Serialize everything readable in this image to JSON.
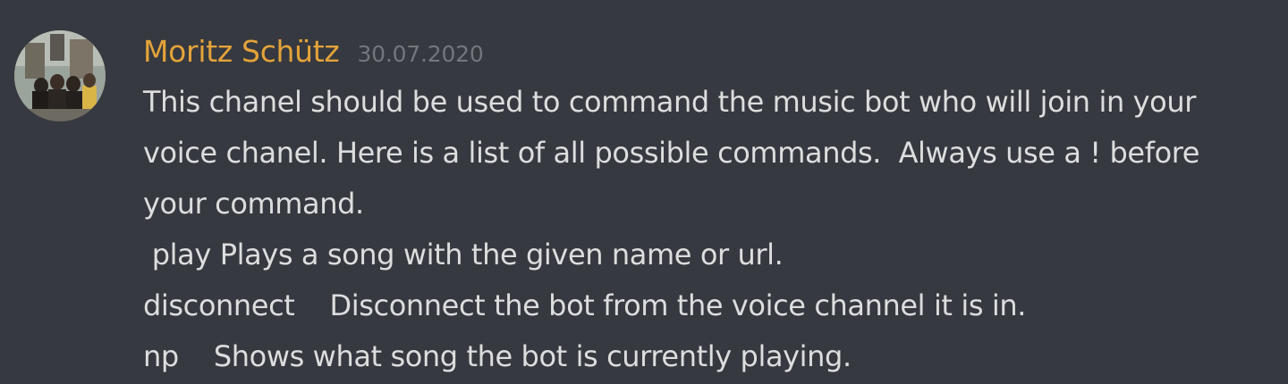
{
  "message": {
    "author": "Moritz Schütz",
    "timestamp": "30.07.2020",
    "colors": {
      "background": "#36393f",
      "author": "#e4a33a",
      "timestamp": "#72767d",
      "text": "#dcddde"
    },
    "lines": [
      "This chanel should be used to command the music bot who will join in your",
      "voice chanel. Here is a list of all possible commands.  Always use a ! before",
      "your command.",
      " play Plays a song with the given name or url.",
      "disconnect    Disconnect the bot from the voice channel it is in.",
      "np    Shows what song the bot is currently playing."
    ]
  }
}
